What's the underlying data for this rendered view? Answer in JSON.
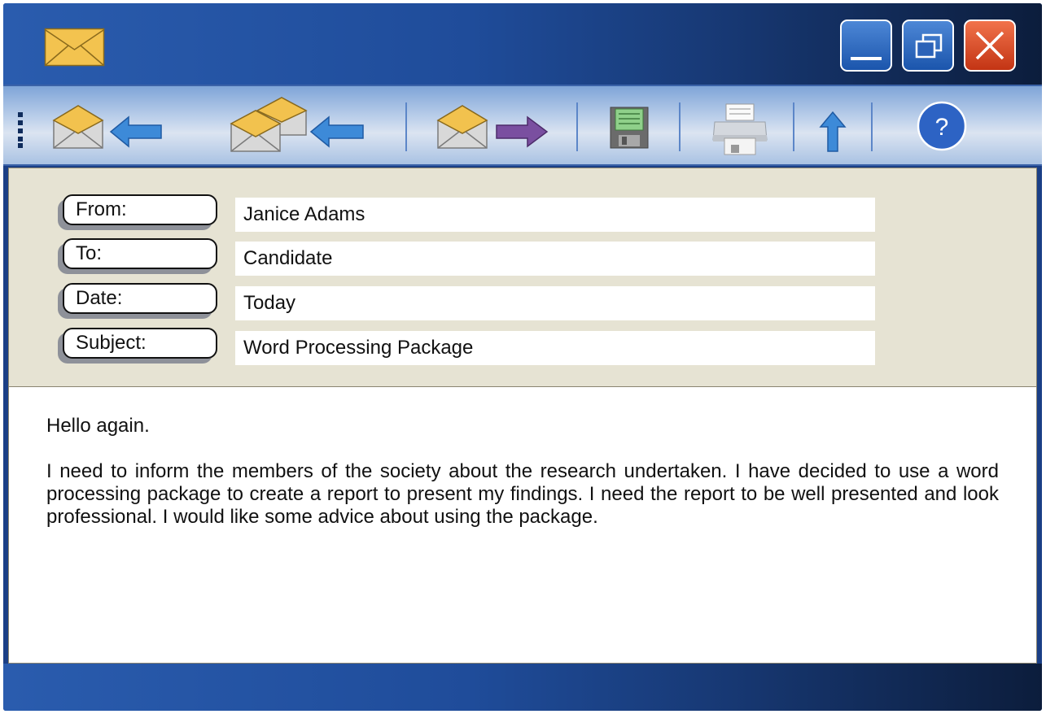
{
  "window": {
    "app_icon": "envelope-icon",
    "controls": {
      "minimize": "minimize-icon",
      "maximize": "maximize-icon",
      "close": "close-icon"
    }
  },
  "toolbar": {
    "items": [
      {
        "name": "reply",
        "icon": "reply-icon"
      },
      {
        "name": "reply-all",
        "icon": "reply-all-icon"
      },
      {
        "name": "forward",
        "icon": "forward-icon"
      },
      {
        "name": "save",
        "icon": "save-icon"
      },
      {
        "name": "print",
        "icon": "print-icon"
      },
      {
        "name": "up",
        "icon": "up-arrow-icon"
      },
      {
        "name": "help",
        "icon": "help-icon",
        "label": "?"
      }
    ]
  },
  "header": {
    "from_label": "From:",
    "from_value": "Janice Adams",
    "to_label": "To:",
    "to_value": "Candidate",
    "date_label": "Date:",
    "date_value": "Today",
    "subject_label": "Subject:",
    "subject_value": "Word Processing Package"
  },
  "message": {
    "greeting": "Hello again.",
    "paragraph": "I need to inform the members of the society about the research undertaken. I have decided to use a word processing package to create a report to present my findings. I need the report to be well presented and look professional. I would like some advice about using the package."
  },
  "colors": {
    "title_bar": "#1f4c9a",
    "close_button": "#d9461f",
    "header_bg": "#e6e3d3",
    "forward_arrow": "#7a4fa0",
    "back_arrow": "#3d8ad8"
  }
}
